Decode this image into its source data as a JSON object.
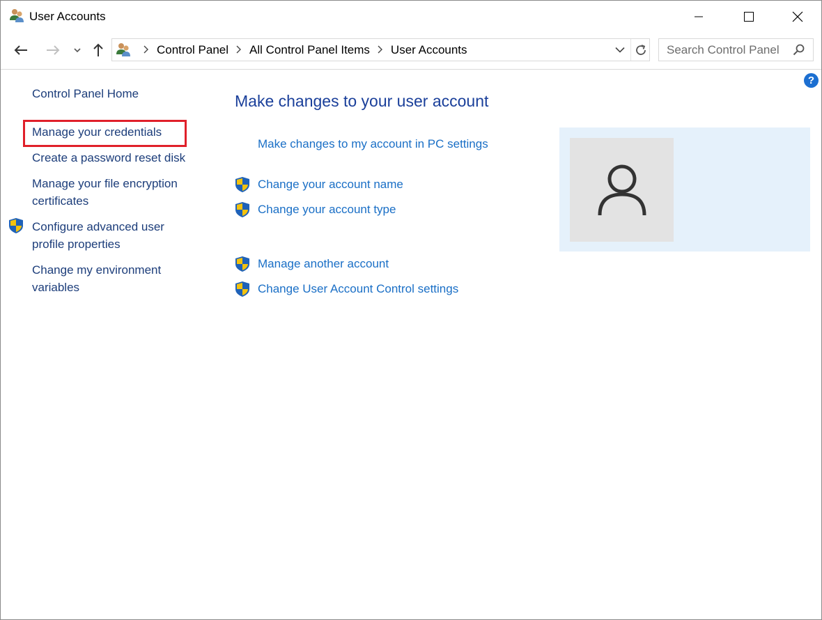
{
  "window": {
    "title": "User Accounts"
  },
  "address": {
    "crumbs": [
      "Control Panel",
      "All Control Panel Items",
      "User Accounts"
    ]
  },
  "search": {
    "placeholder": "Search Control Panel"
  },
  "help": {
    "label": "?"
  },
  "left_pane": {
    "home": "Control Panel Home",
    "links": [
      "Manage your credentials",
      "Create a password reset disk",
      "Manage your file encryption certificates",
      "Configure advanced user profile properties",
      "Change my environment variables"
    ]
  },
  "main": {
    "title": "Make changes to your user account",
    "pc_settings_link": "Make changes to my account in PC settings",
    "links": [
      "Change your account name",
      "Change your account type",
      "Manage another account",
      "Change User Account Control settings"
    ]
  },
  "colors": {
    "link": "#1a6fc6",
    "left_link": "#1c3d7a",
    "heading": "#1a3f9a",
    "highlight": "#e0202a",
    "user_panel": "#e5f1fb",
    "avatar_bg": "#e3e3e3"
  },
  "icons": {
    "title": "users-icon",
    "shield": "uac-shield-icon",
    "avatar": "person-icon"
  }
}
